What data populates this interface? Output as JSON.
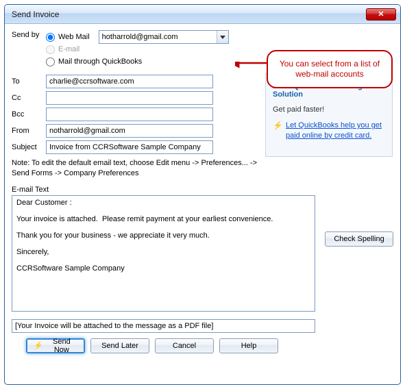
{
  "window": {
    "title": "Send Invoice"
  },
  "callout": {
    "text": "You can select from a list of web-mail accounts"
  },
  "sendby": {
    "label": "Send by",
    "options": {
      "webmail": "Web Mail",
      "email": "E-mail",
      "quickbooks": "Mail through QuickBooks"
    },
    "account_selected": "hotharrold@gmail.com"
  },
  "fields": {
    "to": {
      "label": "To",
      "value": "charlie@ccrsoftware.com"
    },
    "cc": {
      "label": "Cc",
      "value": ""
    },
    "bcc": {
      "label": "Bcc",
      "value": ""
    },
    "from": {
      "label": "From",
      "value": "notharrold@gmail.com"
    },
    "subject": {
      "label": "Subject",
      "value": "Invoice from CCRSoftware Sample Company"
    }
  },
  "note": "Note: To edit the default email text, choose Edit menu -> Preferences... -> Send Forms -> Company Preferences",
  "email_text": {
    "label": "E-mail Text",
    "body": "Dear Customer :\n\nYour invoice is attached.  Please remit payment at your earliest convenience.\n\nThank you for your business - we appreciate it very much.\n\nSincerely,\n\nCCRSoftware Sample Company"
  },
  "attachment_note": "[Your Invoice will be attached to the message as a PDF file]",
  "buttons": {
    "check_spelling": "Check Spelling",
    "send_now": "Send Now",
    "send_later": "Send Later",
    "cancel": "Cancel",
    "help": "Help"
  },
  "promo": {
    "heading": "Intuit QuickBooks Billing Solution",
    "sub": "Get paid faster!",
    "link": "Let QuickBooks help you get paid online by credit card."
  }
}
